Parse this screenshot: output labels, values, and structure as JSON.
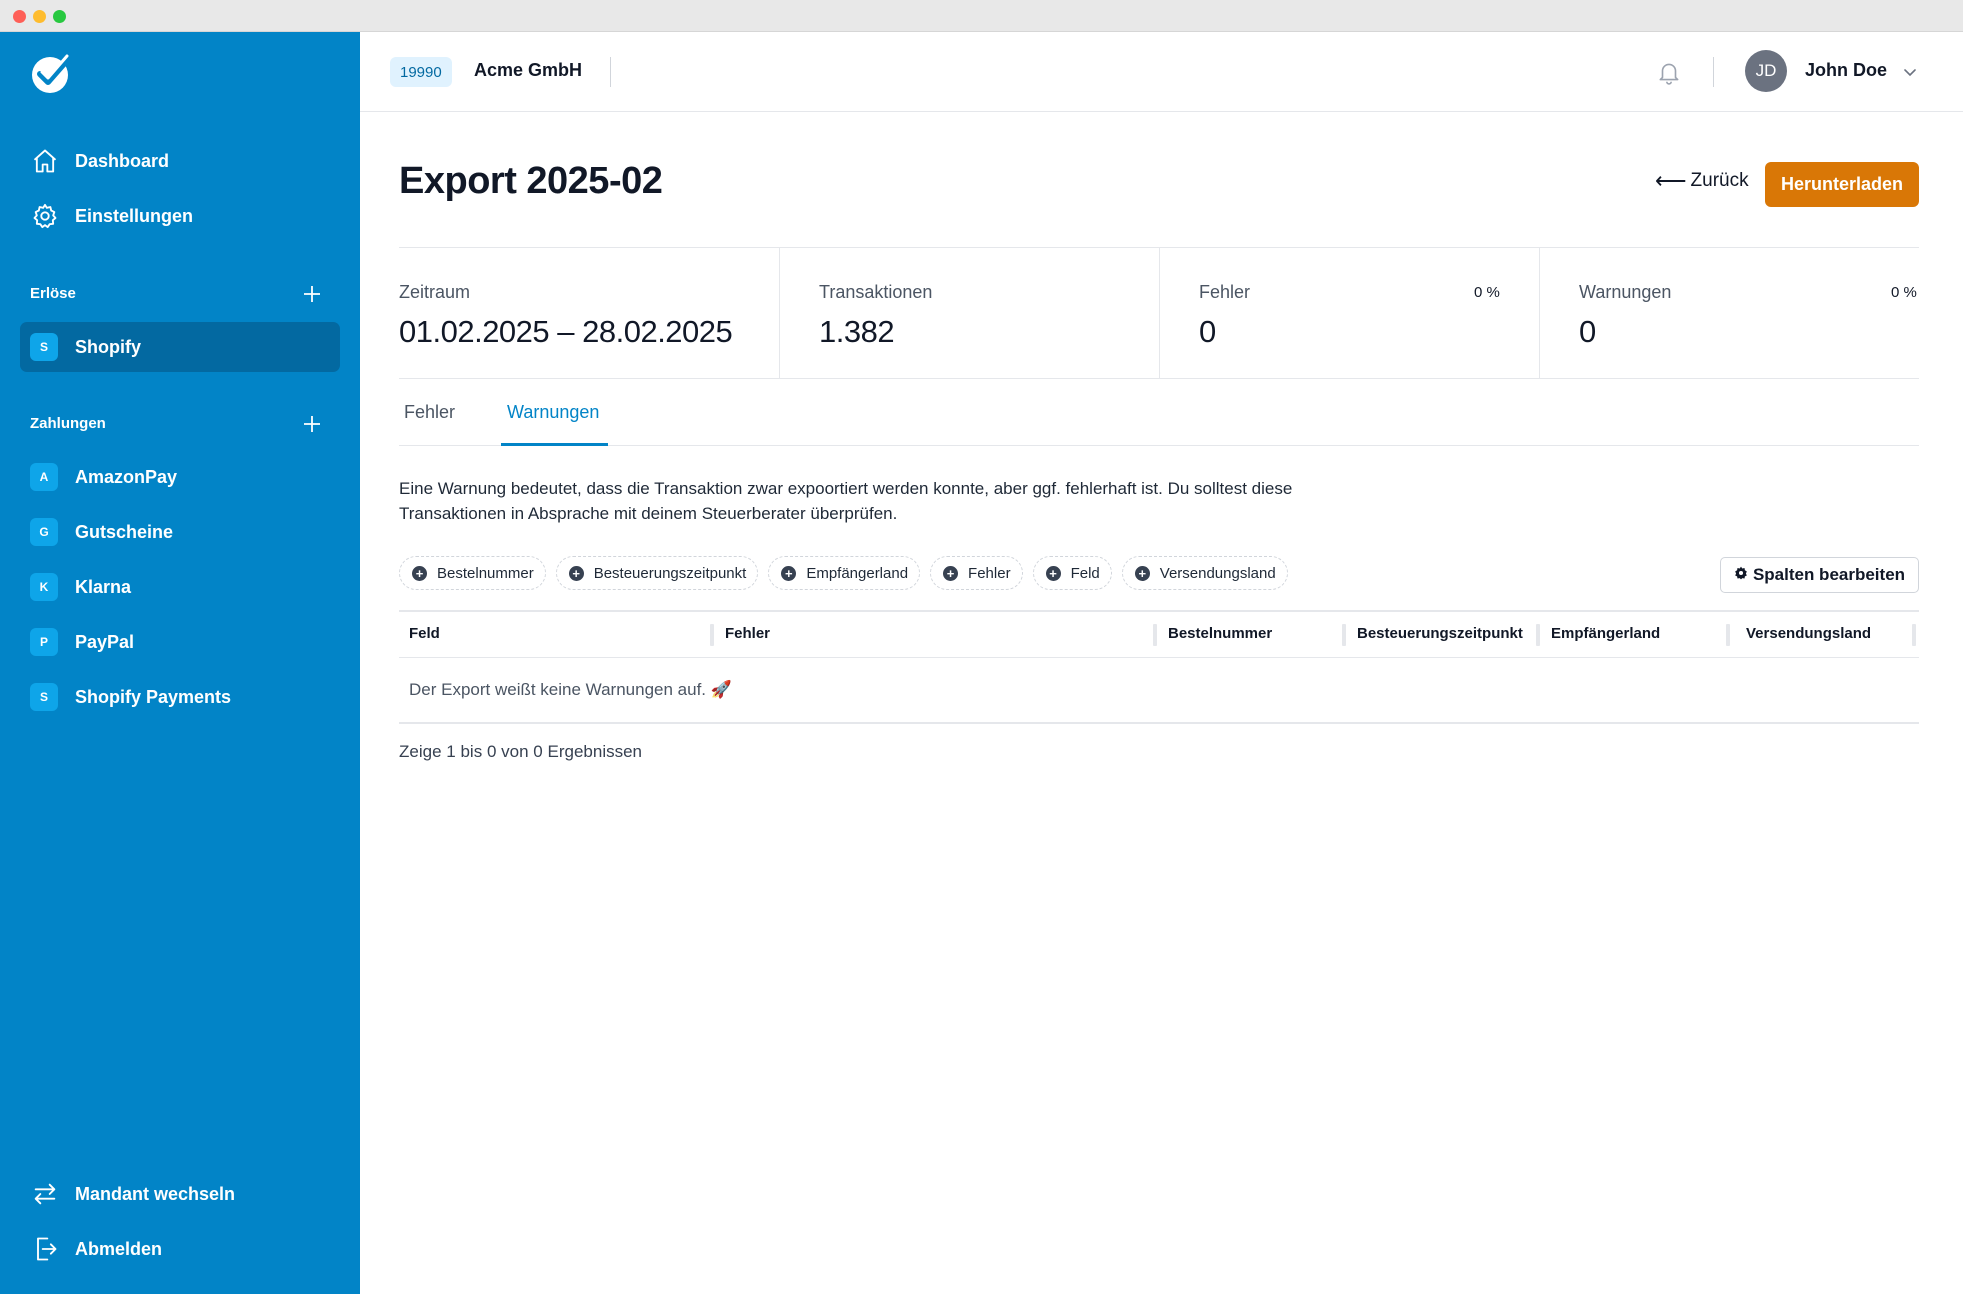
{
  "sidebar": {
    "nav": [
      {
        "label": "Dashboard",
        "icon": "home-icon"
      },
      {
        "label": "Einstellungen",
        "icon": "gear-icon"
      }
    ],
    "revenue_section": {
      "title": "Erlöse",
      "items": [
        {
          "badge": "S",
          "label": "Shopify",
          "active": true
        }
      ]
    },
    "payment_section": {
      "title": "Zahlungen",
      "items": [
        {
          "badge": "A",
          "label": "AmazonPay"
        },
        {
          "badge": "G",
          "label": "Gutscheine"
        },
        {
          "badge": "K",
          "label": "Klarna"
        },
        {
          "badge": "P",
          "label": "PayPal"
        },
        {
          "badge": "S",
          "label": "Shopify Payments"
        }
      ]
    },
    "footer": [
      {
        "label": "Mandant wechseln",
        "icon": "switch-arrows-icon"
      },
      {
        "label": "Abmelden",
        "icon": "logout-icon"
      }
    ]
  },
  "header": {
    "tenant_id": "19990",
    "tenant_name": "Acme GmbH",
    "user_initials": "JD",
    "user_name": "John Doe"
  },
  "page": {
    "title": "Export 2025-02",
    "back_label": "Zurück",
    "download_label": "Herunterladen"
  },
  "stats": [
    {
      "label": "Zeitraum",
      "value": "01.02.2025 – 28.02.2025",
      "pct": ""
    },
    {
      "label": "Transaktionen",
      "value": "1.382",
      "pct": ""
    },
    {
      "label": "Fehler",
      "value": "0",
      "pct": "0 %"
    },
    {
      "label": "Warnungen",
      "value": "0",
      "pct": "0 %"
    }
  ],
  "tabs": [
    {
      "label": "Fehler",
      "active": false
    },
    {
      "label": "Warnungen",
      "active": true
    }
  ],
  "warning_text": "Eine Warnung bedeutet, dass die Transaktion zwar expoortiert werden konnte, aber ggf. fehlerhaft ist. Du solltest diese Transaktionen in Absprache mit deinem Steuerberater überprüfen.",
  "filters": [
    "Bestelnummer",
    "Besteuerungszeitpunkt",
    "Empfängerland",
    "Fehler",
    "Feld",
    "Versendungsland"
  ],
  "edit_columns_label": "Spalten bearbeiten",
  "table": {
    "columns": [
      "Feld",
      "Fehler",
      "Bestelnummer",
      "Besteuerungszeitpunkt",
      "Empfängerland",
      "Versendungsland"
    ],
    "empty_message": "Der Export weißt keine Warnungen auf. 🚀"
  },
  "pagination": {
    "prefix": "Zeige",
    "from": "1",
    "mid1": "bis",
    "to": "0",
    "mid2": "von",
    "total": "0",
    "suffix": "Ergebnissen"
  },
  "colors": {
    "sidebar": "#0284c7",
    "sidebar_active": "#0369a1",
    "accent": "#0284c7",
    "download": "#d97706"
  }
}
